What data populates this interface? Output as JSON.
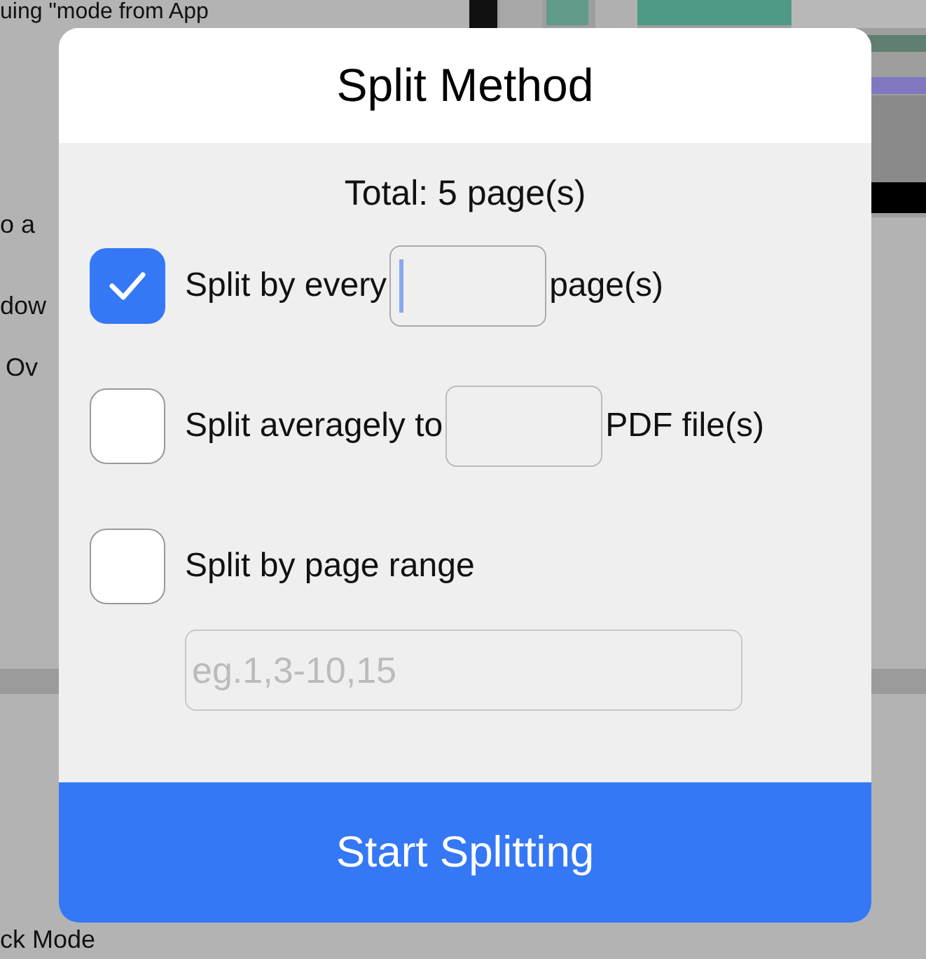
{
  "background_texts": [
    "uing \"mode from App",
    "o a",
    "dow",
    "Ov",
    "ck Mode"
  ],
  "dialog": {
    "title": "Split Method",
    "total": "Total: 5 page(s)",
    "options": [
      {
        "kind": "count",
        "checked": true,
        "focused": true,
        "label": "Split by every",
        "suffix": "page(s)"
      },
      {
        "kind": "count",
        "checked": false,
        "focused": false,
        "label": "Split averagely to",
        "suffix": "PDF file(s)"
      },
      {
        "kind": "range",
        "checked": false,
        "label": "Split by page range",
        "placeholder": "eg.1,3-10,15"
      }
    ],
    "button": "Start Splitting"
  }
}
